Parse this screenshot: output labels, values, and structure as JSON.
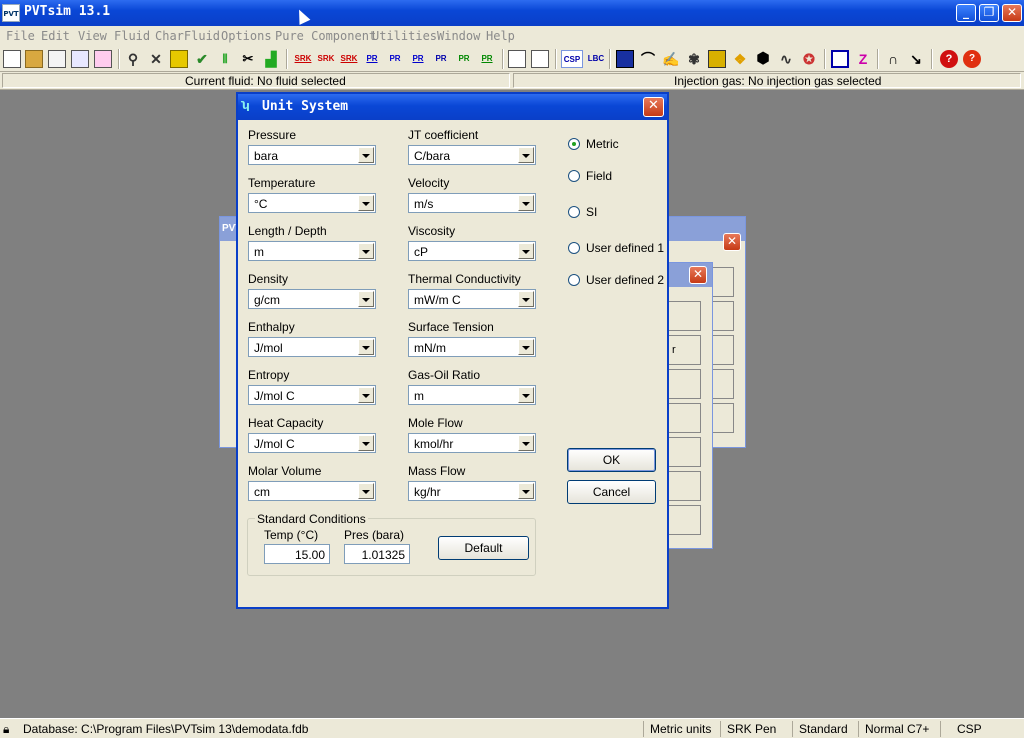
{
  "window": {
    "title": "PVTsim 13.1"
  },
  "menu": [
    "File",
    "Edit",
    "View",
    "Fluid",
    "CharFluid",
    "Options",
    "Pure Component",
    "Utilities",
    "Window",
    "Help"
  ],
  "toolbar_texts": [
    "SRK",
    "SRK",
    "SRK",
    "PR",
    "PR",
    "PR",
    "PR",
    "PR",
    "CSP",
    "LBC"
  ],
  "fluid_bar": {
    "current_fluid": "Current fluid: No fluid selected",
    "injection_gas": "Injection gas: No injection gas selected"
  },
  "dialog": {
    "title": "Unit System",
    "left_fields": [
      {
        "label": "Pressure",
        "value": "bara"
      },
      {
        "label": "Temperature",
        "value": "°C"
      },
      {
        "label": "Length / Depth",
        "value": "m"
      },
      {
        "label": "Density",
        "value": "g/cm"
      },
      {
        "label": "Enthalpy",
        "value": "J/mol"
      },
      {
        "label": "Entropy",
        "value": "J/mol C"
      },
      {
        "label": "Heat Capacity",
        "value": "J/mol C"
      },
      {
        "label": "Molar Volume",
        "value": "cm"
      }
    ],
    "right_fields": [
      {
        "label": "JT coefficient",
        "value": "C/bara"
      },
      {
        "label": "Velocity",
        "value": "m/s"
      },
      {
        "label": "Viscosity",
        "value": "cP"
      },
      {
        "label": "Thermal Conductivity",
        "value": "mW/m C"
      },
      {
        "label": "Surface Tension",
        "value": "mN/m"
      },
      {
        "label": "Gas-Oil Ratio",
        "value": "m"
      },
      {
        "label": "Mole Flow",
        "value": "kmol/hr"
      },
      {
        "label": "Mass Flow",
        "value": "kg/hr"
      }
    ],
    "unit_options": [
      {
        "label": "Metric",
        "selected": true
      },
      {
        "label": "Field",
        "selected": false
      },
      {
        "label": "SI",
        "selected": false
      },
      {
        "label": "User defined 1",
        "selected": false
      },
      {
        "label": "User defined 2",
        "selected": false
      }
    ],
    "ok_label": "OK",
    "cancel_label": "Cancel",
    "standard_conditions": {
      "group_label": "Standard Conditions",
      "temp_label": "Temp (°C)",
      "temp_value": "15.00",
      "pres_label": "Pres (bara)",
      "pres_value": "1.01325",
      "default_label": "Default"
    }
  },
  "background_window_fragment": "r",
  "status": {
    "database": "Database: C:\\Program Files\\PVTsim 13\\demodata.fdb",
    "units": "Metric units",
    "eos": "SRK Pen",
    "mode": "Standard",
    "c7": "Normal C7+",
    "visc": "CSP"
  }
}
